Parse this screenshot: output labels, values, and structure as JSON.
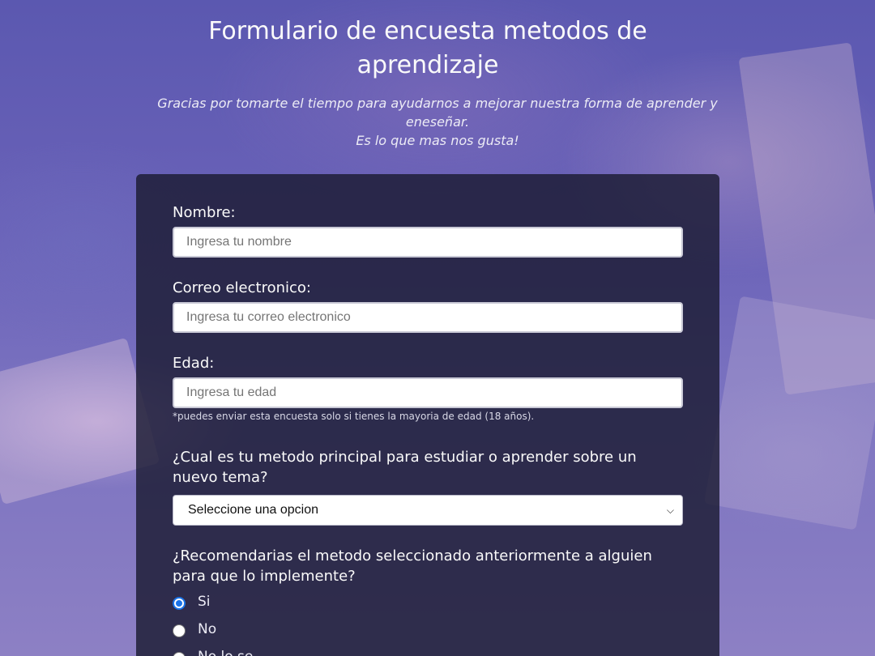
{
  "header": {
    "title": "Formulario de encuesta metodos de aprendizaje",
    "description_line1": "Gracias por tomarte el tiempo para ayudarnos a mejorar nuestra forma de aprender y eneseñar.",
    "description_line2": "Es lo que mas nos gusta!"
  },
  "form": {
    "name": {
      "label": "Nombre:",
      "placeholder": "Ingresa tu nombre"
    },
    "email": {
      "label": "Correo electronico:",
      "placeholder": "Ingresa tu correo electronico"
    },
    "age": {
      "label": "Edad:",
      "placeholder": "Ingresa tu edad",
      "note": "*puedes enviar esta encuesta solo si tienes la mayoria de edad (18 años)."
    },
    "method": {
      "label": "¿Cual es tu metodo principal para estudiar o aprender sobre un nuevo tema?",
      "selected": "Seleccione una opcion"
    },
    "recommend": {
      "label": "¿Recomendarias el metodo seleccionado anteriormente a alguien para que lo implemente?",
      "options": [
        {
          "label": "Si",
          "checked": true
        },
        {
          "label": "No",
          "checked": false
        },
        {
          "label": "No lo se",
          "checked": false
        }
      ]
    }
  },
  "colors": {
    "form_bg": "#1b1b32",
    "radio_accent": "#1a73e8"
  }
}
